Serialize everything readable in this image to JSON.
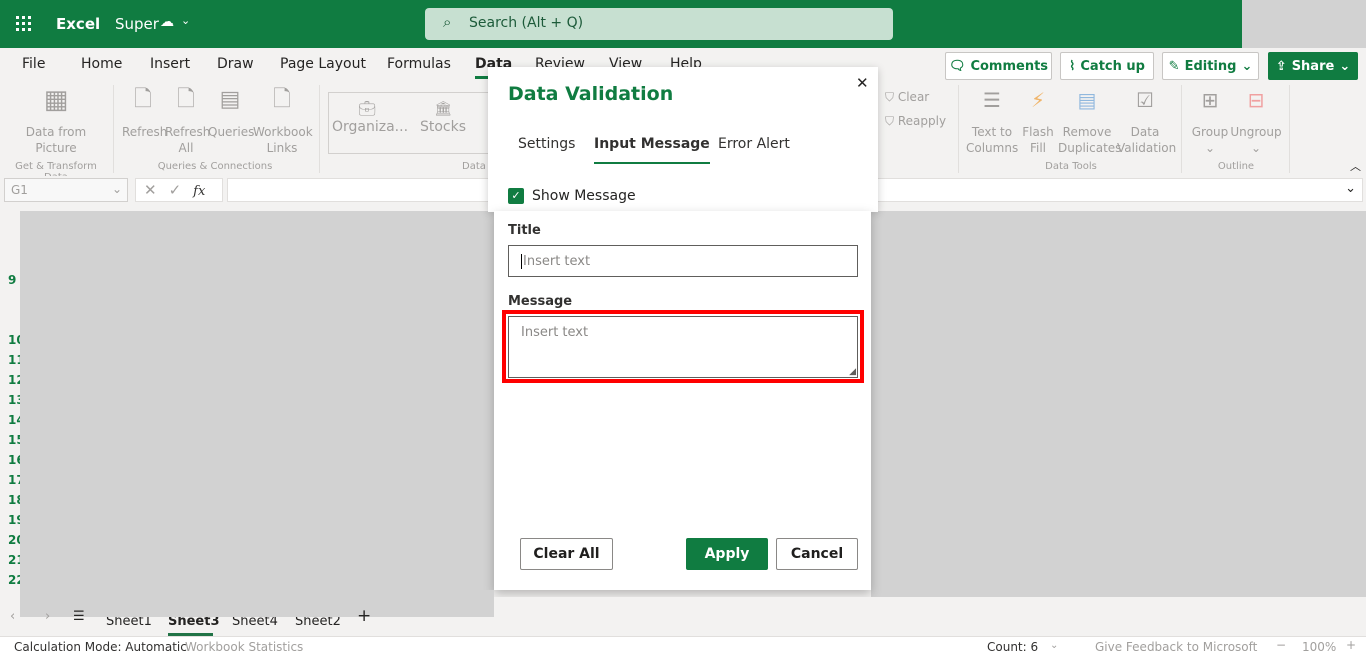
{
  "app": {
    "name": "Excel",
    "file_name": "Super",
    "search_placeholder": "Search (Alt + Q)"
  },
  "ribbon_tabs": [
    "File",
    "Home",
    "Insert",
    "Draw",
    "Page Layout",
    "Formulas",
    "Data",
    "Review",
    "View",
    "Help"
  ],
  "active_tab": "Data",
  "actions": {
    "comments": "Comments",
    "catch_up": "Catch up",
    "editing": "Editing",
    "share": "Share"
  },
  "ribbon": {
    "get_transform": {
      "group": "Get & Transform Data",
      "data_from_picture": [
        "Data from",
        "Picture"
      ]
    },
    "queries": {
      "group": "Queries & Connections",
      "refresh": "Refresh",
      "refresh_all": [
        "Refresh",
        "All"
      ],
      "queries": "Queries",
      "workbook_links": [
        "Workbook",
        "Links"
      ]
    },
    "data_types": {
      "group": "Data Types",
      "organization": "Organiza...",
      "stocks": "Stocks"
    },
    "sort_filter": {
      "clear": "Clear",
      "reapply": "Reapply"
    },
    "data_tools": {
      "group": "Data Tools",
      "text_to_columns": [
        "Text to",
        "Columns"
      ],
      "flash_fill": [
        "Flash",
        "Fill"
      ],
      "remove_duplicates": [
        "Remove",
        "Duplicates"
      ],
      "data_validation": [
        "Data",
        "Validation"
      ]
    },
    "outline": {
      "group": "Outline",
      "group_btn": "Group",
      "ungroup": "Ungroup"
    }
  },
  "formula_bar": {
    "name_box": "G1",
    "fx": "fx",
    "value": ""
  },
  "rows": [
    "9",
    "10",
    "11",
    "12",
    "13",
    "14",
    "15",
    "16",
    "17",
    "18",
    "19",
    "20",
    "21",
    "22"
  ],
  "dialog": {
    "title": "Data Validation",
    "tabs": [
      "Settings",
      "Input Message",
      "Error Alert"
    ],
    "active_tab": "Input Message",
    "show_message_label": "Show Message",
    "show_message_checked": true,
    "title_label": "Title",
    "title_placeholder": "Insert text",
    "message_label": "Message",
    "message_placeholder": "Insert text",
    "clear_all": "Clear All",
    "apply": "Apply",
    "cancel": "Cancel"
  },
  "sheets": [
    "Sheet1",
    "Sheet3",
    "Sheet4",
    "Sheet2"
  ],
  "active_sheet": "Sheet3",
  "status": {
    "calc_mode": "Calculation Mode: Automatic",
    "workbook_stats": "Workbook Statistics",
    "count": "Count: 6",
    "feedback": "Give Feedback to Microsoft",
    "zoom": "100%"
  },
  "colors": {
    "brand": "#107c41",
    "highlight": "#ff0000",
    "overlay": "#d2d2d2"
  }
}
